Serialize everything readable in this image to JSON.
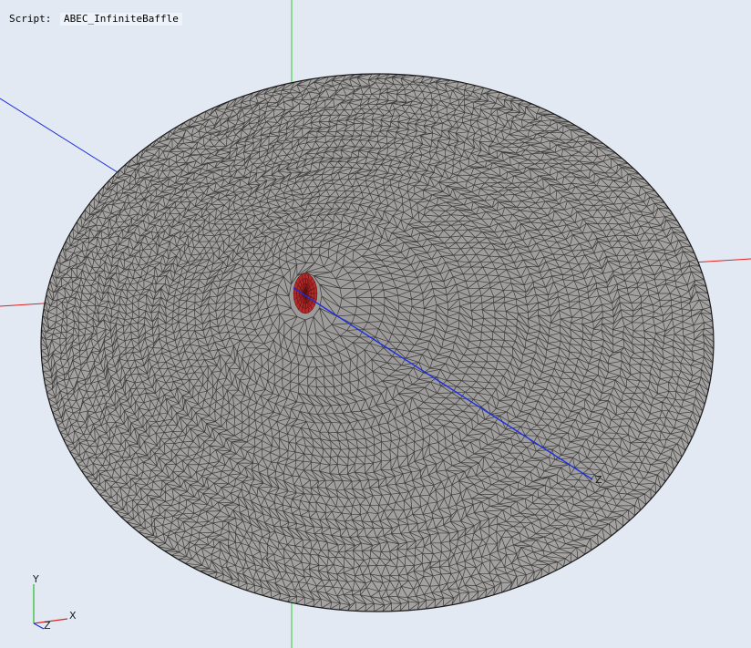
{
  "script": {
    "label": "Script:",
    "value": "ABEC_InfiniteBaffle"
  },
  "axis_indicator": {
    "x_label": "X",
    "y_label": "Y",
    "z_label": "Z"
  },
  "scene": {
    "background_color": "#e3e9f3",
    "mesh_face_color": "#a4a2a0",
    "mesh_edge_color": "#2a2a2a",
    "driver_color": "#b22a2a",
    "axis_x_color": "#e02020",
    "axis_y_color": "#20c020",
    "axis_z_color": "#1a2ee0"
  },
  "z_axis_tip_label": "Z"
}
